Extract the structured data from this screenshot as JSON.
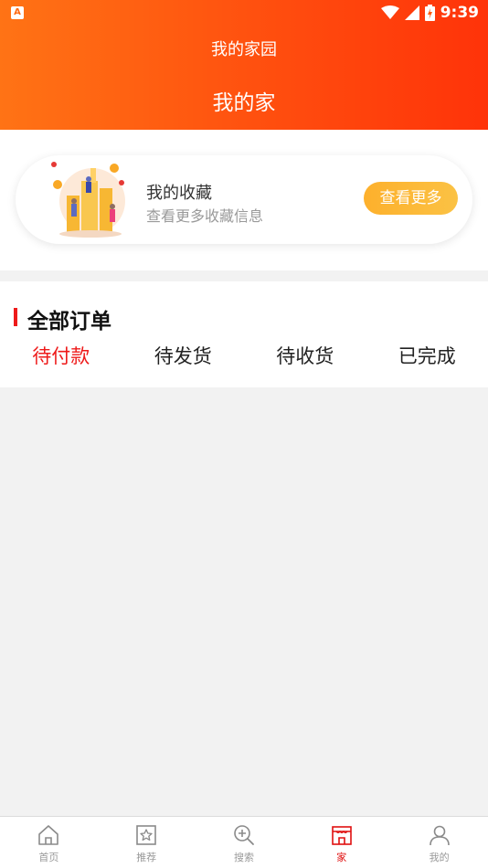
{
  "status_bar": {
    "left_icon": "A",
    "time": "9:39",
    "icons": [
      "wifi-icon",
      "signal-icon",
      "battery-icon"
    ]
  },
  "header": {
    "window_title": "我的家园",
    "page_title": "我的家"
  },
  "favorites": {
    "title": "我的收藏",
    "subtitle": "查看更多收藏信息",
    "button_label": "查看更多"
  },
  "orders": {
    "title": "全部订单",
    "tabs": [
      {
        "label": "待付款",
        "active": true
      },
      {
        "label": "待发货",
        "active": false
      },
      {
        "label": "待收货",
        "active": false
      },
      {
        "label": "已完成",
        "active": false
      }
    ]
  },
  "tabbar": {
    "items": [
      {
        "label": "首页",
        "icon": "home-icon"
      },
      {
        "label": "推荐",
        "icon": "recommend-icon"
      },
      {
        "label": "搜索",
        "icon": "search-icon"
      },
      {
        "label": "家",
        "icon": "house-icon",
        "active": true
      },
      {
        "label": "我的",
        "icon": "user-icon"
      }
    ]
  },
  "colors": {
    "header_gradient_start": "#ff7315",
    "header_gradient_end": "#ff3309",
    "accent_red": "#ee1a1a",
    "button_orange": "#fdb02c",
    "background": "#f2f2f2"
  }
}
